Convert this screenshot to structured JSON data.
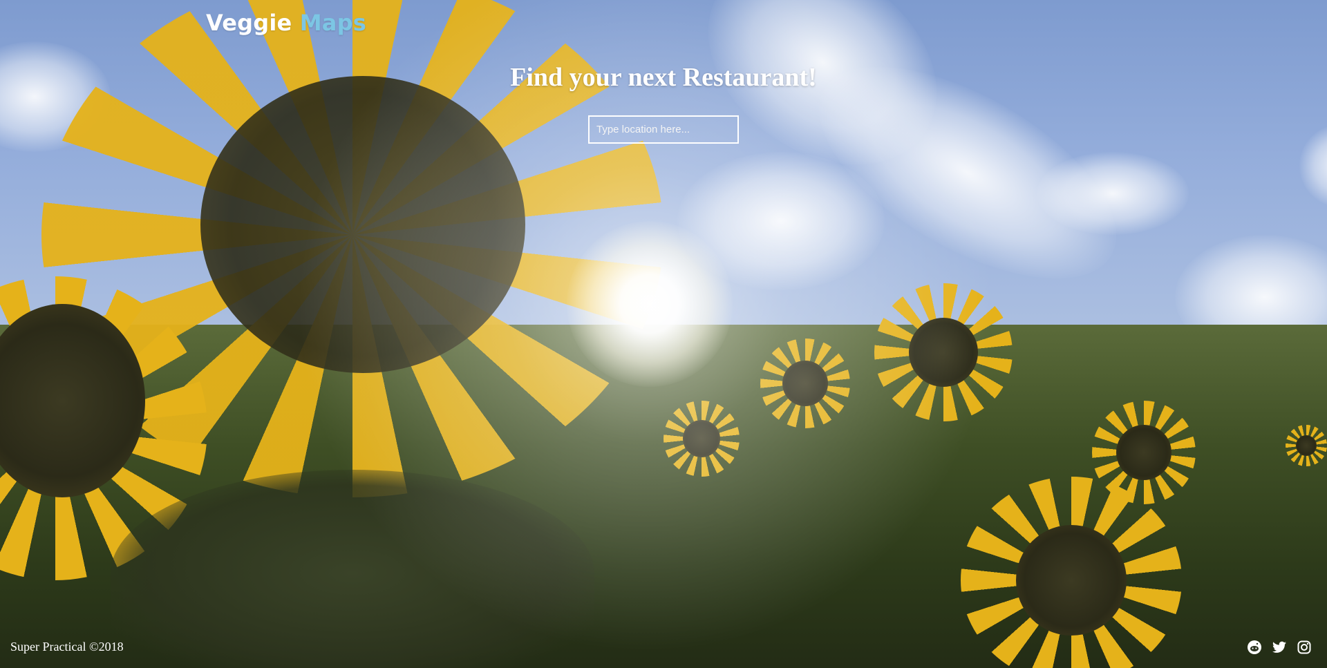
{
  "brand": {
    "part1": "Veggie",
    "part2": "Maps"
  },
  "hero": {
    "title": "Find your next Restaurant!"
  },
  "search": {
    "placeholder": "Type location here..."
  },
  "footer": {
    "copyright": "Super Practical ©2018",
    "social": [
      {
        "icon": "reddit-icon"
      },
      {
        "icon": "twitter-icon"
      },
      {
        "icon": "instagram-icon"
      }
    ]
  },
  "colors": {
    "brand_accent": "#7cc6e4",
    "text": "#ffffff"
  }
}
